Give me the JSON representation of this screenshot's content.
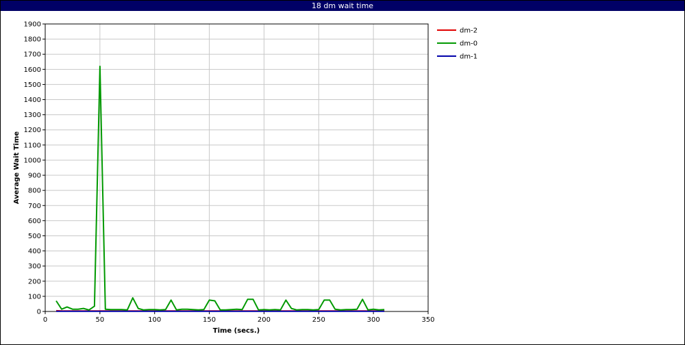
{
  "window": {
    "title": "18 dm wait time"
  },
  "chart_data": {
    "type": "line",
    "title": "18 dm wait time",
    "xlabel": "Time (secs.)",
    "ylabel": "Average Wait Time",
    "xlim": [
      0,
      350
    ],
    "ylim": [
      0,
      1900
    ],
    "x_ticks": [
      0,
      50,
      100,
      150,
      200,
      250,
      300,
      350
    ],
    "y_ticks": [
      0,
      100,
      200,
      300,
      400,
      500,
      600,
      700,
      800,
      900,
      1000,
      1100,
      1200,
      1300,
      1400,
      1500,
      1600,
      1700,
      1800,
      1900
    ],
    "grid": true,
    "legend": "right",
    "series": [
      {
        "name": "dm-2",
        "color": "#e00000",
        "x": [
          10,
          15,
          20,
          25,
          30,
          35,
          40,
          45,
          50,
          55,
          60,
          65,
          70,
          75,
          80,
          85,
          90,
          95,
          100,
          105,
          110,
          115,
          120,
          125,
          130,
          135,
          140,
          145,
          150,
          155,
          160,
          165,
          170,
          175,
          180,
          185,
          190,
          195,
          200,
          205,
          210,
          215,
          220,
          225,
          230,
          235,
          240,
          245,
          250,
          255,
          260,
          265,
          270,
          275,
          280,
          285,
          290,
          295,
          300,
          305,
          310
        ],
        "y": [
          5,
          3,
          3,
          3,
          3,
          3,
          3,
          3,
          3,
          3,
          3,
          3,
          3,
          3,
          3,
          3,
          3,
          3,
          3,
          3,
          3,
          3,
          3,
          3,
          3,
          3,
          3,
          3,
          3,
          3,
          3,
          3,
          3,
          3,
          3,
          3,
          3,
          3,
          3,
          3,
          3,
          3,
          3,
          3,
          3,
          3,
          3,
          3,
          3,
          3,
          3,
          3,
          3,
          3,
          3,
          3,
          3,
          3,
          3,
          3,
          3
        ]
      },
      {
        "name": "dm-0",
        "color": "#009900",
        "x": [
          10,
          15,
          20,
          25,
          30,
          35,
          40,
          45,
          50,
          55,
          60,
          65,
          70,
          75,
          80,
          85,
          90,
          95,
          100,
          105,
          110,
          115,
          120,
          125,
          130,
          135,
          140,
          145,
          150,
          155,
          160,
          165,
          170,
          175,
          180,
          185,
          190,
          195,
          200,
          205,
          210,
          215,
          220,
          225,
          230,
          235,
          240,
          245,
          250,
          255,
          260,
          265,
          270,
          275,
          280,
          285,
          290,
          295,
          300,
          305,
          310
        ],
        "y": [
          70,
          15,
          30,
          15,
          15,
          20,
          10,
          35,
          1620,
          15,
          12,
          12,
          12,
          10,
          90,
          20,
          10,
          12,
          12,
          10,
          12,
          75,
          10,
          15,
          15,
          12,
          10,
          12,
          75,
          70,
          10,
          10,
          12,
          15,
          12,
          80,
          80,
          10,
          12,
          10,
          12,
          10,
          75,
          20,
          10,
          12,
          12,
          10,
          12,
          75,
          75,
          15,
          10,
          12,
          12,
          15,
          80,
          10,
          15,
          10,
          12
        ]
      },
      {
        "name": "dm-1",
        "color": "#0000aa",
        "x": [
          10,
          310
        ],
        "y": [
          1,
          1
        ]
      }
    ]
  }
}
